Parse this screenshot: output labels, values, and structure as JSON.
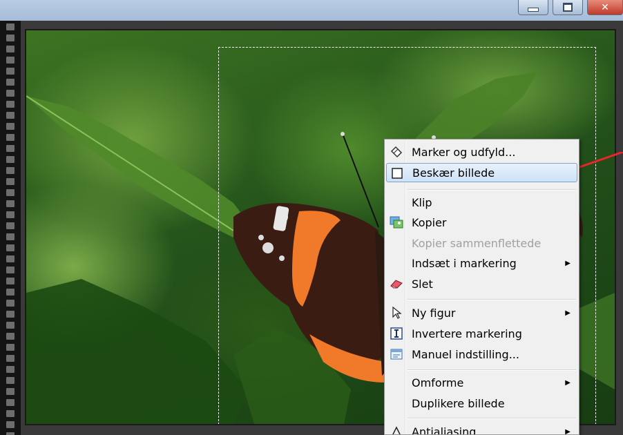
{
  "window": {
    "close_symbol": "✕"
  },
  "context_menu": {
    "items": [
      {
        "label": "Marker og udfyld...",
        "icon": "magic-fill-icon"
      },
      {
        "label": "Beskær billede",
        "icon": "crop-icon",
        "highlighted": true
      },
      {
        "label": "Klip",
        "icon": ""
      },
      {
        "label": "Kopier",
        "icon": "copy-image-icon"
      },
      {
        "label": "Kopier sammenflettede",
        "icon": "",
        "disabled": true
      },
      {
        "label": "Indsæt i markering",
        "icon": "",
        "submenu": true
      },
      {
        "label": "Slet",
        "icon": "eraser-icon"
      },
      {
        "label": "Ny figur",
        "icon": "cursor-icon",
        "submenu": true
      },
      {
        "label": "Invertere markering",
        "icon": "invert-selection-icon"
      },
      {
        "label": "Manuel indstilling...",
        "icon": "manual-settings-icon"
      },
      {
        "label": "Omforme",
        "icon": "",
        "submenu": true
      },
      {
        "label": "Duplikere billede",
        "icon": ""
      },
      {
        "label": "Antialiasing",
        "icon": "triangle-icon",
        "submenu": true
      }
    ],
    "submenu_arrow": "▶"
  },
  "colors": {
    "highlight_border": "#7da2ce",
    "annotation_arrow": "#e8262b"
  }
}
